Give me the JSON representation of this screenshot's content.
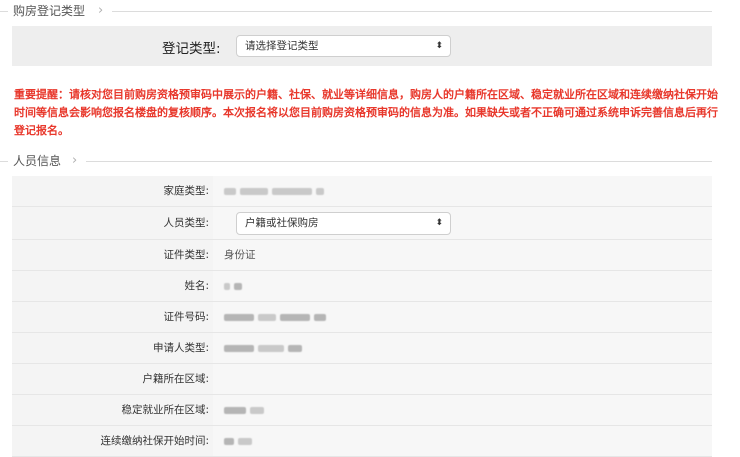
{
  "registration": {
    "section_title": "购房登记类型",
    "type_label": "登记类型:",
    "type_select_value": "请选择登记类型"
  },
  "notice": {
    "text": "重要提醒：请核对您目前购房资格预审码中展示的户籍、社保、就业等详细信息，购房人的户籍所在区域、稳定就业所在区域和连续缴纳社保开始时间等信息会影响您报名楼盘的复核顺序。本次报名将以您目前购房资格预审码的信息为准。如果缺失或者不正确可通过系统申诉完善信息后再行登记报名。"
  },
  "person": {
    "section_title": "人员信息",
    "rows": [
      {
        "label": "家庭类型:",
        "value": ""
      },
      {
        "label": "人员类型:",
        "value": "户籍或社保购房"
      },
      {
        "label": "证件类型:",
        "value": "身份证"
      },
      {
        "label": "姓名:",
        "value": ""
      },
      {
        "label": "证件号码:",
        "value": ""
      },
      {
        "label": "申请人类型:",
        "value": ""
      },
      {
        "label": "户籍所在区域:",
        "value": ""
      },
      {
        "label": "稳定就业所在区域:",
        "value": ""
      },
      {
        "label": "连续缴纳社保开始时间:",
        "value": ""
      }
    ]
  },
  "icons": {
    "section_chevron": "chevron-right-icon",
    "select_arrow": "updown-arrow-icon"
  },
  "colors": {
    "warning_red": "#e8382c",
    "row_bg": "#f7f7f7"
  }
}
